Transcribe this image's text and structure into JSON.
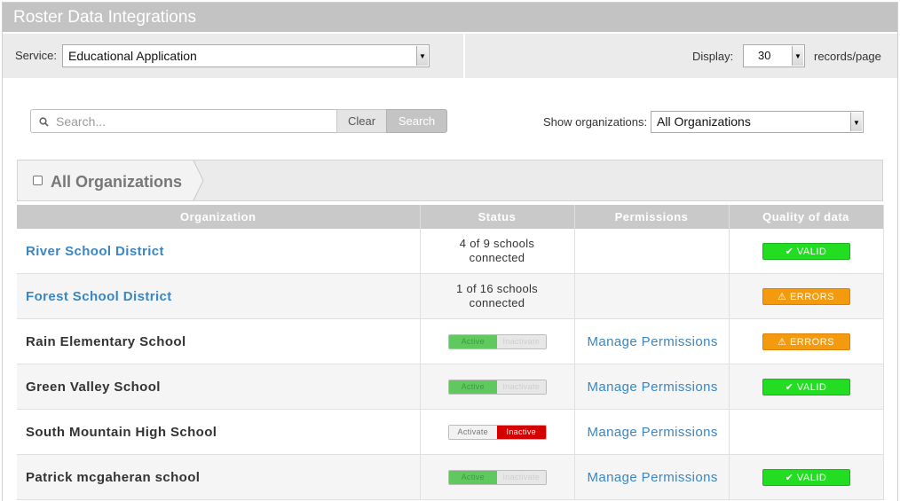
{
  "header": {
    "title": "Roster Data Integrations"
  },
  "service": {
    "label": "Service:",
    "selected": "Educational Application"
  },
  "display": {
    "label": "Display:",
    "selected": "30",
    "suffix": "records/page"
  },
  "search": {
    "placeholder": "Search...",
    "clear_label": "Clear",
    "search_label": "Search"
  },
  "filter": {
    "label": "Show organizations:",
    "selected": "All Organizations"
  },
  "breadcrumb": {
    "label": "All Organizations"
  },
  "table": {
    "columns": [
      "Organization",
      "Status",
      "Permissions",
      "Quality of data"
    ],
    "rows": [
      {
        "name": "River School District",
        "status_line1": "4 of 9 schools",
        "status_line2": "connected",
        "quality": "VALID"
      },
      {
        "name": "Forest School District",
        "status_line1": "1 of 16 schools",
        "status_line2": "connected",
        "quality": "ERRORS"
      },
      {
        "name": "Rain Elementary School",
        "toggle_left": "Active",
        "toggle_right": "Inactivate",
        "permission": "Manage Permissions",
        "quality": "ERRORS"
      },
      {
        "name": "Green Valley School",
        "toggle_left": "Active",
        "toggle_right": "Inactivate",
        "permission": "Manage Permissions",
        "quality": "VALID"
      },
      {
        "name": "South Mountain High School",
        "toggle_left": "Activate",
        "toggle_right": "Inactive",
        "permission": "Manage Permissions",
        "quality": ""
      },
      {
        "name": "Patrick mcgaheran school",
        "toggle_left": "Active",
        "toggle_right": "Inactivate",
        "permission": "Manage Permissions",
        "quality": "VALID"
      }
    ]
  },
  "colors": {
    "link": "#3a86c4",
    "valid": "#22dd22",
    "errors": "#f39a0e",
    "inactive": "#d40000",
    "active": "#5fc85f"
  },
  "icons": {
    "search": "search-icon",
    "check": "check-icon",
    "warning": "warning-icon",
    "dropdown": "chevron-down-icon"
  }
}
